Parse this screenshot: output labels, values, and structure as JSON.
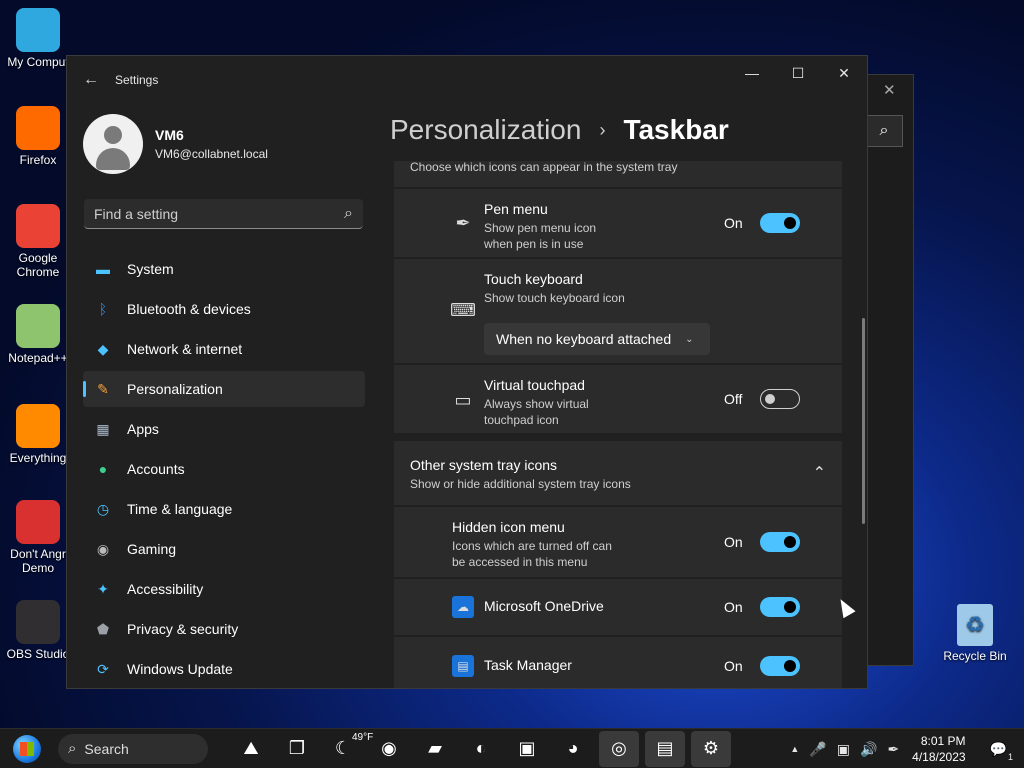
{
  "desktop": {
    "icons_left": [
      {
        "label": "My Comput",
        "glyph": "monitor-icon",
        "color": "#2fa8e0"
      },
      {
        "label": "Firefox",
        "glyph": "firefox-icon",
        "color": "#ff6a00"
      },
      {
        "label": "Google Chrome",
        "glyph": "chrome-icon",
        "color": "#ea4335"
      },
      {
        "label": "Notepad++",
        "glyph": "notepad-icon",
        "color": "#8fc46f"
      },
      {
        "label": "Everything",
        "glyph": "everything-icon",
        "color": "#ff8a00"
      },
      {
        "label": "Don't Angr Demo",
        "glyph": "game-icon",
        "color": "#d93030"
      },
      {
        "label": "OBS Studio",
        "glyph": "obs-icon",
        "color": "#302e31"
      }
    ],
    "recycle_bin": "Recycle Bin"
  },
  "window": {
    "title": "Settings",
    "back_glyph": "←",
    "controls": {
      "minimize": "—",
      "maximize": "☐",
      "close": "✕"
    }
  },
  "profile": {
    "name": "VM6",
    "email": "VM6@collabnet.local"
  },
  "search": {
    "placeholder": "Find a setting",
    "icon": "⌕"
  },
  "nav": [
    {
      "label": "System",
      "icon": "system-icon",
      "glyph": "▬",
      "color": "#4cc2ff",
      "active": false
    },
    {
      "label": "Bluetooth & devices",
      "icon": "bluetooth-icon",
      "glyph": "ᛒ",
      "color": "#3b8ee8",
      "active": false
    },
    {
      "label": "Network & internet",
      "icon": "wifi-icon",
      "glyph": "◆",
      "color": "#4cc2ff",
      "active": false
    },
    {
      "label": "Personalization",
      "icon": "brush-icon",
      "glyph": "✎",
      "color": "#f7a23e",
      "active": true
    },
    {
      "label": "Apps",
      "icon": "apps-icon",
      "glyph": "▦",
      "color": "#a9b8c8",
      "active": false
    },
    {
      "label": "Accounts",
      "icon": "accounts-icon",
      "glyph": "●",
      "color": "#3ccf8e",
      "active": false
    },
    {
      "label": "Time & language",
      "icon": "clock-icon",
      "glyph": "◷",
      "color": "#4cc2ff",
      "active": false
    },
    {
      "label": "Gaming",
      "icon": "gamepad-icon",
      "glyph": "◉",
      "color": "#b9b9b9",
      "active": false
    },
    {
      "label": "Accessibility",
      "icon": "accessibility-icon",
      "glyph": "✦",
      "color": "#4cc2ff",
      "active": false
    },
    {
      "label": "Privacy & security",
      "icon": "shield-icon",
      "glyph": "⬟",
      "color": "#9aa0a6",
      "active": false
    },
    {
      "label": "Windows Update",
      "icon": "update-icon",
      "glyph": "⟳",
      "color": "#4cc2ff",
      "active": false
    }
  ],
  "breadcrumb": {
    "parent": "Personalization",
    "separator": "›",
    "current": "Taskbar"
  },
  "content": {
    "top_desc": "Choose which icons can appear in the system tray",
    "pen_menu": {
      "title": "Pen menu",
      "desc1": "Show pen menu icon",
      "desc2": "when pen is in use",
      "state": "On",
      "icon_glyph": "✒"
    },
    "touch_keyboard": {
      "title": "Touch keyboard",
      "desc": "Show touch keyboard icon",
      "dropdown": "When no keyboard attached",
      "icon_glyph": "⌨"
    },
    "virtual_touchpad": {
      "title": "Virtual touchpad",
      "desc1": "Always show virtual",
      "desc2": "touchpad icon",
      "state": "Off",
      "icon_glyph": "▭"
    },
    "other_section": {
      "title": "Other system tray icons",
      "desc": "Show or hide additional system tray icons",
      "chevron": "⌃"
    },
    "hidden_icon_menu": {
      "title": "Hidden icon menu",
      "desc1": "Icons which are turned off can",
      "desc2": "be accessed in this menu",
      "state": "On"
    },
    "onedrive": {
      "title": "Microsoft OneDrive",
      "state": "On",
      "badge_color": "#1a73d9"
    },
    "task_manager": {
      "title": "Task Manager",
      "state": "On",
      "badge_color": "#1a73d9"
    }
  },
  "bg_window": {
    "close": "✕",
    "search": "⌕"
  },
  "taskbar": {
    "search_label": "Search",
    "search_icon": "⌕",
    "weather": "49°F",
    "apps": [
      {
        "name": "widgets-icon",
        "glyph": "⛰",
        "active": false
      },
      {
        "name": "task-view-icon",
        "glyph": "❐",
        "active": false
      },
      {
        "name": "weather-app-icon",
        "glyph": "☾",
        "active": false
      },
      {
        "name": "zoom-icon",
        "glyph": "◉",
        "active": false
      },
      {
        "name": "file-explorer-icon",
        "glyph": "▰",
        "active": false
      },
      {
        "name": "edge-icon",
        "glyph": "◐",
        "active": false
      },
      {
        "name": "store-icon",
        "glyph": "▣",
        "active": false
      },
      {
        "name": "chrome-icon",
        "glyph": "◕",
        "active": false
      },
      {
        "name": "obs-icon",
        "glyph": "◎",
        "active": true
      },
      {
        "name": "remote-desktop-icon",
        "glyph": "▤",
        "active": true
      },
      {
        "name": "settings-icon",
        "glyph": "⚙",
        "active": true
      }
    ],
    "tray": {
      "chevron": "▲",
      "mic": "🎤",
      "network": "▣",
      "volume": "🔊",
      "pen": "✒"
    },
    "time": "8:01 PM",
    "date": "4/18/2023",
    "notification_glyph": "💬",
    "notification_count": "1"
  }
}
